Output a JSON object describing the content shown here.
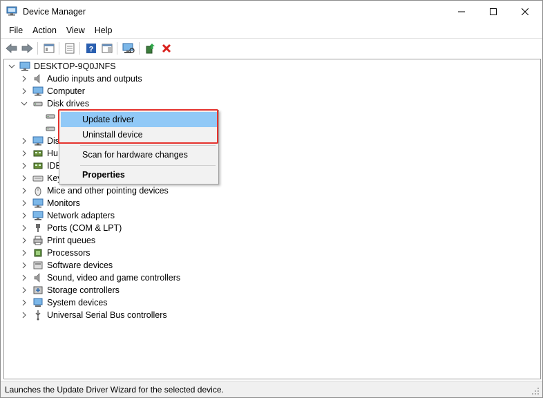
{
  "window": {
    "title": "Device Manager",
    "minimize_glyph": "—",
    "maximize_glyph": "☐",
    "close_glyph": "✕"
  },
  "menu": [
    "File",
    "Action",
    "View",
    "Help"
  ],
  "toolbar": {
    "icons": [
      "back-icon",
      "forward-icon",
      "show-hide-console-tree-icon",
      "properties-icon",
      "help-icon",
      "action-pane-icon",
      "scan-hardware-icon",
      "update-driver-icon",
      "uninstall-icon"
    ]
  },
  "tree": {
    "root": "DESKTOP-9Q0JNFS",
    "categories": [
      {
        "label": "Audio inputs and outputs",
        "icon": "speaker-icon"
      },
      {
        "label": "Computer",
        "icon": "monitor-icon"
      },
      {
        "label": "Disk drives",
        "icon": "disk-drive-icon",
        "expanded": true
      },
      {
        "label": "Dis",
        "icon": "display-adapter-icon"
      },
      {
        "label": "Hu",
        "icon": "hid-icon"
      },
      {
        "label": "IDE",
        "icon": "ide-controller-icon"
      },
      {
        "label": "Key",
        "icon": "keyboard-icon"
      },
      {
        "label": "Mice and other pointing devices",
        "icon": "mouse-icon"
      },
      {
        "label": "Monitors",
        "icon": "monitor-icon"
      },
      {
        "label": "Network adapters",
        "icon": "network-icon"
      },
      {
        "label": "Ports (COM & LPT)",
        "icon": "port-icon"
      },
      {
        "label": "Print queues",
        "icon": "printer-icon"
      },
      {
        "label": "Processors",
        "icon": "processor-icon"
      },
      {
        "label": "Software devices",
        "icon": "software-device-icon"
      },
      {
        "label": "Sound, video and game controllers",
        "icon": "sound-icon"
      },
      {
        "label": "Storage controllers",
        "icon": "storage-controller-icon"
      },
      {
        "label": "System devices",
        "icon": "system-device-icon"
      },
      {
        "label": "Universal Serial Bus controllers",
        "icon": "usb-icon"
      }
    ]
  },
  "context_menu": {
    "items": [
      "Update driver",
      "Uninstall device",
      "Scan for hardware changes",
      "Properties"
    ],
    "highlighted": "Update driver",
    "accent": "#e5322d",
    "hover_color": "#91c9f7"
  },
  "status": "Launches the Update Driver Wizard for the selected device."
}
